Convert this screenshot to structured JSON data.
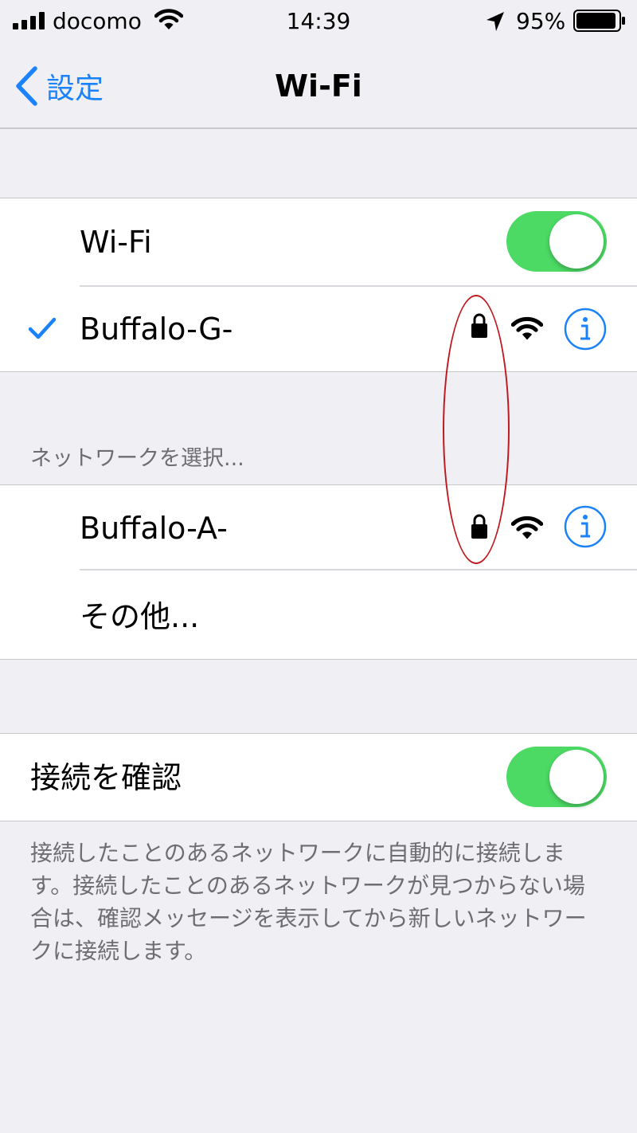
{
  "status_bar": {
    "carrier": "docomo",
    "time": "14:39",
    "battery": "95%",
    "battery_level": 0.95
  },
  "nav": {
    "back_label": "設定",
    "title": "Wi-Fi"
  },
  "wifi_section": {
    "wifi_label": "Wi-Fi",
    "wifi_enabled": true,
    "connected_network": "Buffalo-G-"
  },
  "networks_section": {
    "header": "ネットワークを選択...",
    "networks": [
      {
        "name": "Buffalo-A-",
        "secured": true
      }
    ],
    "other_label": "その他..."
  },
  "ask_section": {
    "label": "接続を確認",
    "enabled": true,
    "footer": "接続したことのあるネットワークに自動的に接続します。接続したことのあるネットワークが見つからない場合は、確認メッセージを表示してから新しいネットワークに接続します。"
  },
  "colors": {
    "accent": "#1a82fb",
    "toggle_on": "#4cd964",
    "annotation": "#c0181f",
    "background": "#efeff4"
  },
  "icons": [
    "signal-icon",
    "wifi-icon",
    "location-icon",
    "battery-icon",
    "chevron-left-icon",
    "checkmark-icon",
    "lock-icon",
    "info-icon"
  ]
}
